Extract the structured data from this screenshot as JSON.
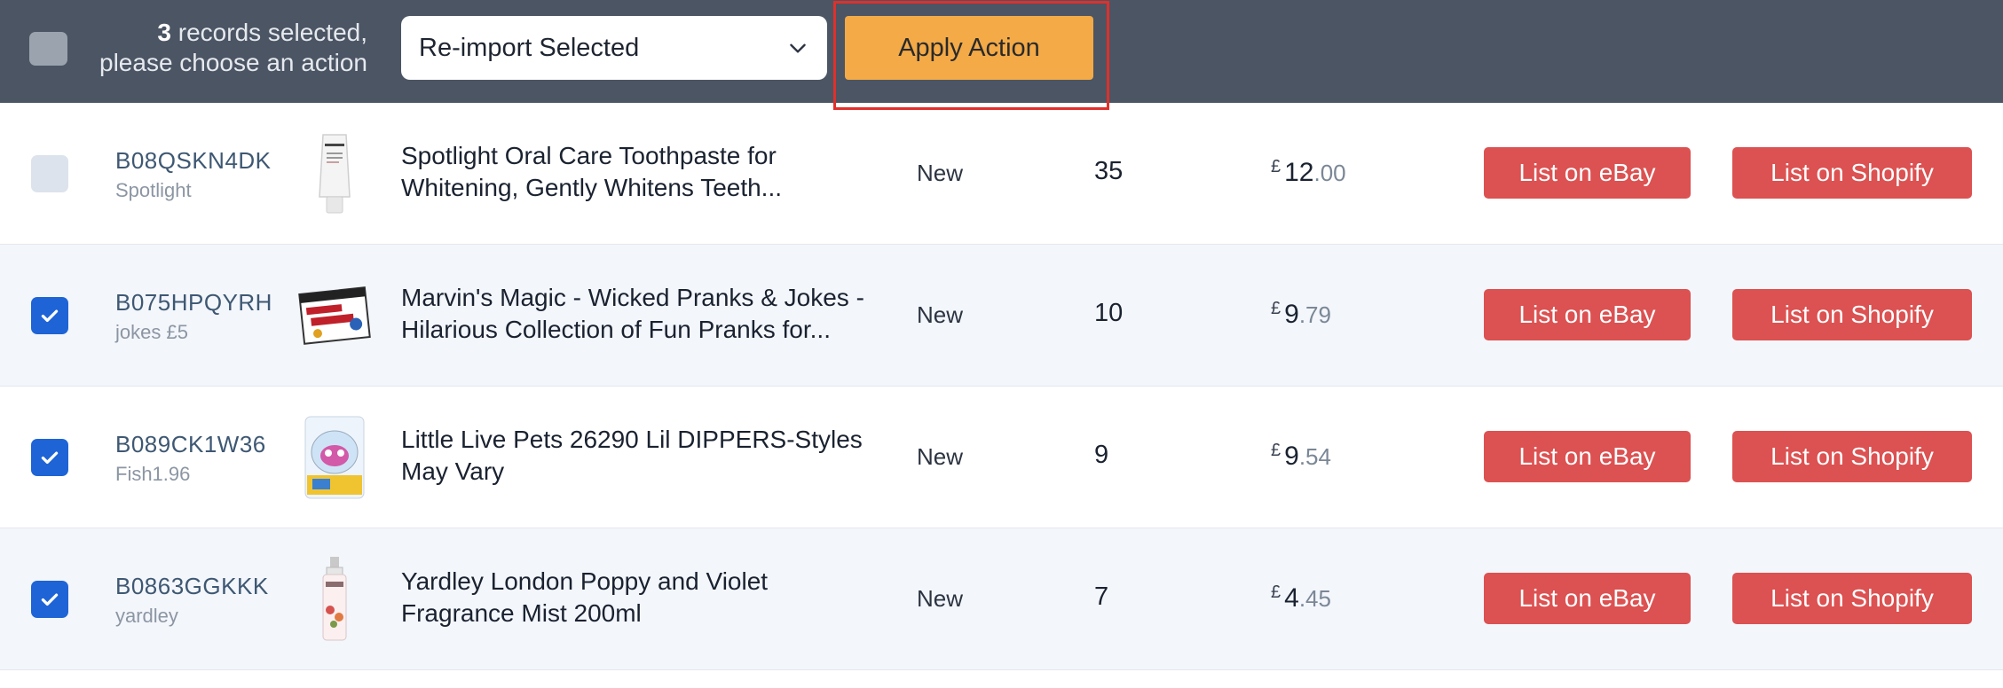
{
  "bulk": {
    "count": "3",
    "text_line1_suffix": " records selected,",
    "text_line2": "please choose an action",
    "select_value": "Re-import Selected",
    "apply_label": "Apply Action"
  },
  "actions": {
    "ebay_label": "List on eBay",
    "shopify_label": "List on Shopify"
  },
  "colors": {
    "bar": "#4b5564",
    "apply": "#f3aa47",
    "highlight": "#e0302b",
    "list_button": "#dc5151",
    "checkbox_checked": "#1e64d6"
  },
  "rows": [
    {
      "checked": false,
      "sku": "B08QSKN4DK",
      "sub": "Spotlight",
      "image": "toothpaste-tube-image",
      "title": "Spotlight Oral Care Toothpaste for Whitening, Gently Whitens Teeth...",
      "condition": "New",
      "qty": "35",
      "currency": "£",
      "price_main": "12",
      "price_cents": ".00"
    },
    {
      "checked": true,
      "sku": "B075HPQYRH",
      "sub": "jokes £5",
      "image": "pranks-box-image",
      "title": "Marvin's Magic - Wicked Pranks & Jokes - Hilarious Collection of Fun Pranks for...",
      "condition": "New",
      "qty": "10",
      "currency": "£",
      "price_main": "9",
      "price_cents": ".79"
    },
    {
      "checked": true,
      "sku": "B089CK1W36",
      "sub": "Fish1.96",
      "image": "toy-package-image",
      "title": "Little Live Pets 26290 Lil DIPPERS-Styles May Vary",
      "condition": "New",
      "qty": "9",
      "currency": "£",
      "price_main": "9",
      "price_cents": ".54"
    },
    {
      "checked": true,
      "sku": "B0863GGKKK",
      "sub": "yardley",
      "image": "mist-bottle-image",
      "title": "Yardley London Poppy and Violet Fragrance Mist 200ml",
      "condition": "New",
      "qty": "7",
      "currency": "£",
      "price_main": "4",
      "price_cents": ".45"
    }
  ]
}
